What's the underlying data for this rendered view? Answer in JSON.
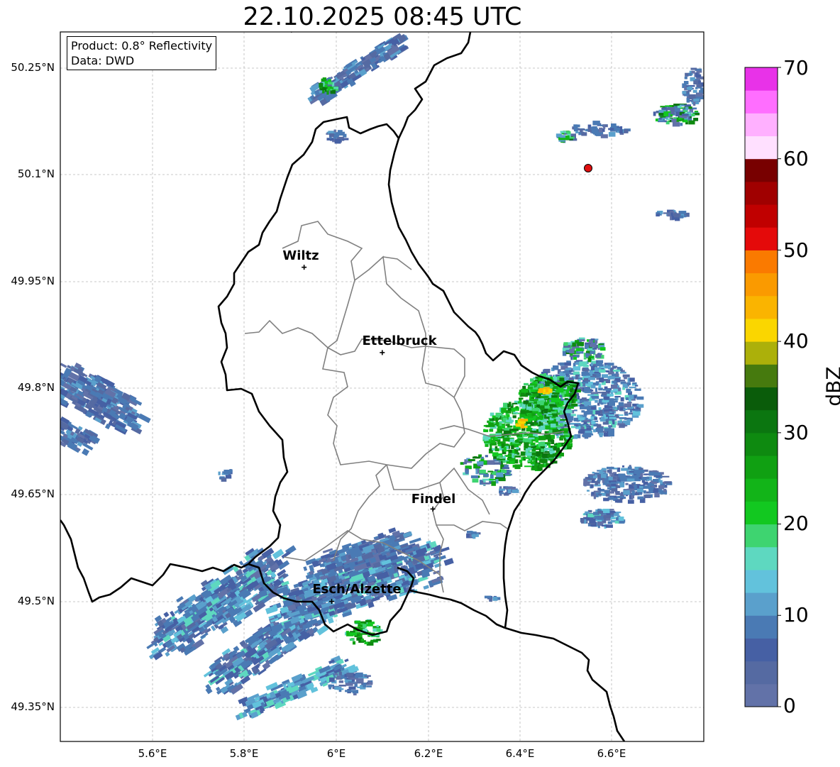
{
  "title": "22.10.2025 08:45 UTC",
  "info": {
    "product": "Product: 0.8° Reflectivity",
    "data": "Data: DWD"
  },
  "axes": {
    "y_labels": [
      "50.25°N",
      "50.1°N",
      "49.95°N",
      "49.8°N",
      "49.65°N",
      "49.5°N",
      "49.35°N"
    ],
    "x_labels": [
      "5.6°E",
      "5.8°E",
      "6°E",
      "6.2°E",
      "6.4°E",
      "6.6°E"
    ]
  },
  "cities": [
    {
      "name": "Wiltz",
      "lon": 5.93,
      "lat": 49.97
    },
    {
      "name": "Ettelbruck",
      "lon": 6.1,
      "lat": 49.85
    },
    {
      "name": "Findel",
      "lon": 6.21,
      "lat": 49.63
    },
    {
      "name": "Esch/Alzette",
      "lon": 5.99,
      "lat": 49.5
    }
  ],
  "radar_site_color": "#e01010",
  "colorbar": {
    "label": "dBZ",
    "ticks": [
      "0",
      "10",
      "20",
      "30",
      "40",
      "50",
      "60",
      "70"
    ],
    "colors": [
      "#6272a8",
      "#556aa2",
      "#4660a4",
      "#4a7ab4",
      "#5aa0cc",
      "#62c2dc",
      "#5ed8c0",
      "#3ed470",
      "#12c820",
      "#12b418",
      "#10a012",
      "#0e8a10",
      "#0b7610",
      "#0a5c0a",
      "#467a0e",
      "#acb00a",
      "#fad600",
      "#fab400",
      "#fa9a00",
      "#fa7a00",
      "#e40a0a",
      "#c00000",
      "#a00000",
      "#780000",
      "#ffe0ff",
      "#ffb0ff",
      "#ff6eff",
      "#e832e8"
    ]
  }
}
